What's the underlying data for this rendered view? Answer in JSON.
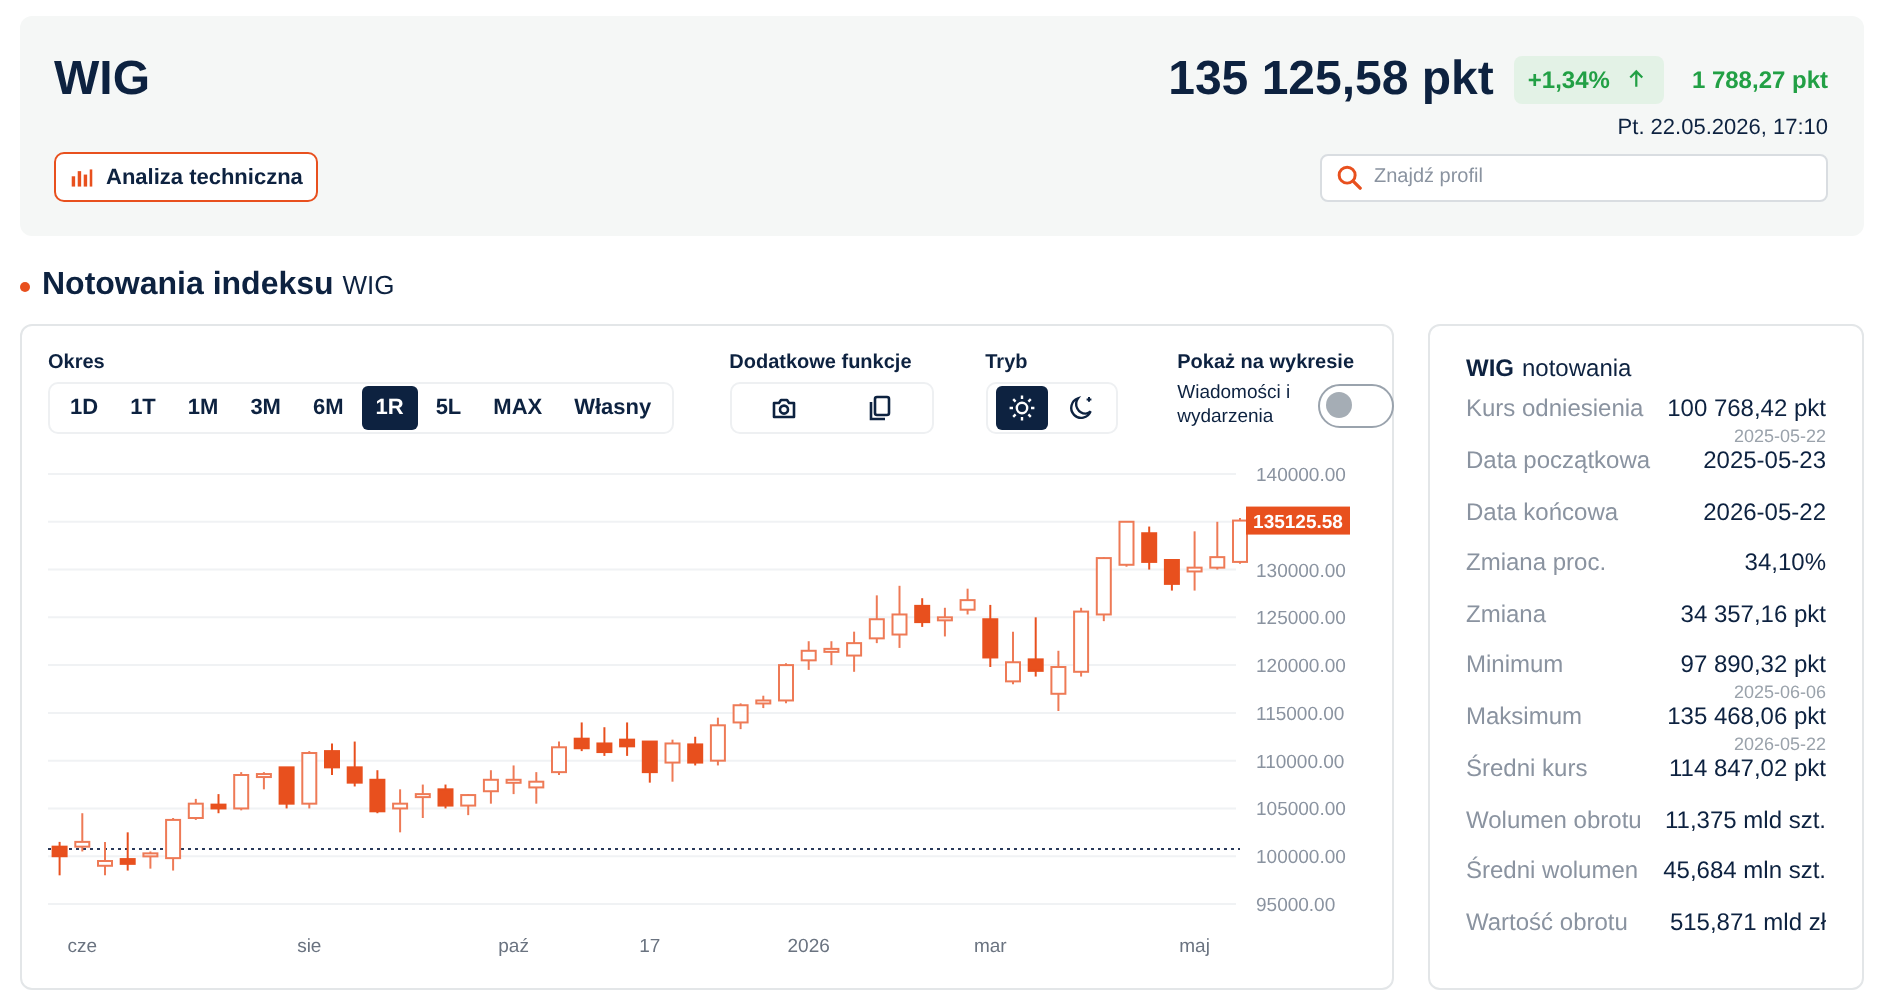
{
  "header": {
    "title": "WIG",
    "price": "135 125,58 pkt",
    "change_pct": "+1,34%",
    "change_abs": "1 788,27 pkt",
    "timestamp": "Pt. 22.05.2026, 17:10",
    "analysis_button": "Analiza techniczna",
    "search": {
      "placeholder": "Znajdź profil"
    }
  },
  "section_title": {
    "text": "Notowania indeksu",
    "suffix": "WIG"
  },
  "controls": {
    "period": {
      "label": "Okres",
      "options": [
        {
          "label": "1D",
          "selected": false
        },
        {
          "label": "1T",
          "selected": false
        },
        {
          "label": "1M",
          "selected": false
        },
        {
          "label": "3M",
          "selected": false
        },
        {
          "label": "6M",
          "selected": false
        },
        {
          "label": "1R",
          "selected": true
        },
        {
          "label": "5L",
          "selected": false
        },
        {
          "label": "MAX",
          "selected": false
        },
        {
          "label": "Własny",
          "selected": false
        }
      ]
    },
    "extra": {
      "label": "Dodatkowe funkcje",
      "actions": [
        {
          "kind": "camera"
        },
        {
          "kind": "copy"
        }
      ]
    },
    "mode": {
      "label": "Tryb",
      "options": [
        {
          "kind": "light",
          "selected": true
        },
        {
          "kind": "dark",
          "selected": false
        }
      ]
    },
    "show_on_chart": {
      "label": "Pokaż na wykresie",
      "toggle_label": "Wiadomości i wydarzenia",
      "on": false
    }
  },
  "chart": {
    "last_price_label": "135125.58",
    "chart_data": {
      "type": "candlestick",
      "categories": [
        null,
        "cze",
        null,
        null,
        null,
        null,
        null,
        null,
        null,
        null,
        null,
        "sie",
        null,
        null,
        null,
        null,
        null,
        null,
        null,
        null,
        "paź",
        null,
        null,
        null,
        null,
        null,
        "17",
        null,
        null,
        null,
        null,
        null,
        null,
        "2026",
        null,
        null,
        null,
        null,
        null,
        null,
        null,
        "mar",
        null,
        null,
        null,
        null,
        null,
        null,
        null,
        null,
        "maj",
        null,
        null
      ],
      "ylim": [
        95000,
        140000
      ],
      "grid": true,
      "ohlc": [
        [
          101000,
          101500,
          98000,
          100000
        ],
        [
          101000,
          104500,
          100500,
          101500
        ],
        [
          99000,
          101500,
          98000,
          99500
        ],
        [
          99700,
          102500,
          98500,
          99200
        ],
        [
          100000,
          100500,
          98700,
          100300
        ],
        [
          99800,
          104000,
          98500,
          103800
        ],
        [
          104000,
          106000,
          103800,
          105500
        ],
        [
          105400,
          106500,
          104500,
          105000
        ],
        [
          105000,
          108800,
          104800,
          108500
        ],
        [
          108300,
          108800,
          107000,
          108600
        ],
        [
          109300,
          109300,
          105000,
          105500
        ],
        [
          105500,
          111000,
          105000,
          110800
        ],
        [
          111000,
          111800,
          108500,
          109300
        ],
        [
          109300,
          112000,
          107300,
          107700
        ],
        [
          108000,
          109000,
          104500,
          104700
        ],
        [
          105000,
          107000,
          102500,
          105500
        ],
        [
          106300,
          107500,
          104000,
          106500
        ],
        [
          107000,
          107500,
          105000,
          105300
        ],
        [
          105300,
          106500,
          104300,
          106400
        ],
        [
          106800,
          109000,
          105500,
          108000
        ],
        [
          107800,
          109500,
          106500,
          108000
        ],
        [
          107200,
          108800,
          105500,
          107800
        ],
        [
          108800,
          112000,
          108500,
          111400
        ],
        [
          112300,
          114000,
          111000,
          111300
        ],
        [
          111800,
          113500,
          110500,
          110900
        ],
        [
          112200,
          114000,
          110500,
          111500
        ],
        [
          112000,
          112000,
          107700,
          108800
        ],
        [
          109800,
          112200,
          107800,
          111800
        ],
        [
          111700,
          112500,
          109500,
          109800
        ],
        [
          110000,
          114500,
          109500,
          113700
        ],
        [
          114000,
          116000,
          113300,
          115800
        ],
        [
          116000,
          116800,
          115500,
          116300
        ],
        [
          116300,
          120200,
          116000,
          120000
        ],
        [
          120500,
          122500,
          119500,
          121500
        ],
        [
          121500,
          122500,
          120000,
          121700
        ],
        [
          121000,
          123500,
          119300,
          122300
        ],
        [
          122800,
          127300,
          122300,
          124800
        ],
        [
          123200,
          128300,
          121800,
          125300
        ],
        [
          126200,
          127000,
          124000,
          124500
        ],
        [
          124800,
          126000,
          123000,
          125000
        ],
        [
          125800,
          128000,
          125300,
          126800
        ],
        [
          124800,
          126300,
          119800,
          120800
        ],
        [
          118300,
          123500,
          118000,
          120300
        ],
        [
          120600,
          125000,
          118800,
          119400
        ],
        [
          117000,
          121500,
          115200,
          119800
        ],
        [
          119300,
          126000,
          118800,
          125600
        ],
        [
          125300,
          131300,
          124600,
          131200
        ],
        [
          130500,
          135000,
          130300,
          135000
        ],
        [
          133800,
          134500,
          130000,
          130800
        ],
        [
          131000,
          131000,
          127800,
          128500
        ],
        [
          129800,
          134000,
          127800,
          130200
        ],
        [
          130200,
          135000,
          130000,
          131300
        ],
        [
          130800,
          135400,
          130600,
          135126
        ]
      ],
      "yticks": [
        {
          "value": 140000,
          "label": "140000.00"
        },
        {
          "value": 130000,
          "label": "130000.00"
        },
        {
          "value": 125000,
          "label": "125000.00"
        },
        {
          "value": 120000,
          "label": "120000.00"
        },
        {
          "value": 115000,
          "label": "115000.00"
        },
        {
          "value": 110000,
          "label": "110000.00"
        },
        {
          "value": 105000,
          "label": "105000.00"
        },
        {
          "value": 100000,
          "label": "100000.00"
        },
        {
          "value": 95000,
          "label": "95000.00"
        }
      ],
      "ref_lines": [
        {
          "axis": "y",
          "value": 100768.42
        }
      ]
    }
  },
  "stats": {
    "title": "WIG",
    "subtitle": "notowania",
    "rows": [
      {
        "label": "Kurs odniesienia",
        "value": "100 768,42 pkt",
        "date": "2025-05-22"
      },
      {
        "label": "Data początkowa",
        "value": "2025-05-23"
      },
      {
        "label": "Data końcowa",
        "value": "2026-05-22"
      },
      {
        "label": "Zmiana proc.",
        "value": "34,10%"
      },
      {
        "label": "Zmiana",
        "value": "34 357,16 pkt"
      },
      {
        "label": "Minimum",
        "value": "97 890,32 pkt",
        "date": "2025-06-06"
      },
      {
        "label": "Maksimum",
        "value": "135 468,06 pkt",
        "date": "2026-05-22"
      },
      {
        "label": "Średni kurs",
        "value": "114 847,02 pkt"
      },
      {
        "label": "Wolumen obrotu",
        "value": "11,375 mld szt."
      },
      {
        "label": "Średni wolumen",
        "value": "45,684 mln szt."
      },
      {
        "label": "Wartość obrotu",
        "value": "515,871 mld zł"
      }
    ]
  }
}
